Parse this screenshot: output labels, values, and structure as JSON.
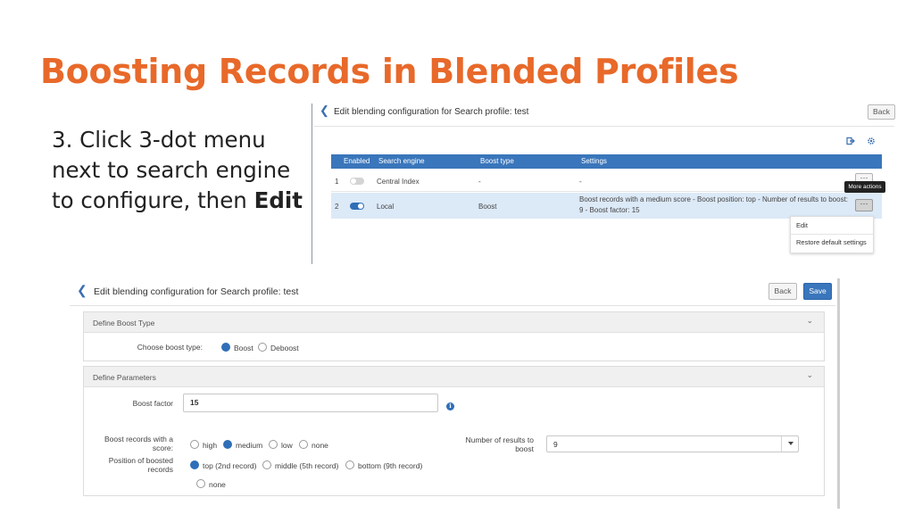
{
  "slide": {
    "title": "Boosting Records in Blended Profiles",
    "instruction_prefix": "3. Click 3-dot menu next to search engine to configure, then ",
    "instruction_bold": "Edit",
    "title_color": "#e8692a"
  },
  "top_screenshot": {
    "header_title": "Edit blending configuration for Search profile: test",
    "back_label": "Back",
    "toolbar_icons": [
      "export-icon",
      "gear-icon"
    ],
    "table": {
      "columns": [
        "Enabled",
        "Search engine",
        "Boost type",
        "Settings"
      ],
      "rows": [
        {
          "num": "1",
          "enabled": false,
          "engine": "Central Index",
          "boost_type": "-",
          "settings": "-"
        },
        {
          "num": "2",
          "enabled": true,
          "engine": "Local",
          "boost_type": "Boost",
          "settings_line1": "Boost records with a medium score - Boost position: top - Number of results to boost:",
          "settings_line2": "9 - Boost factor: 15"
        }
      ]
    },
    "more_actions_tooltip": "More actions",
    "row_actions_glyph": "···",
    "menu_items": [
      "Edit",
      "Restore default settings"
    ],
    "header_color": "#3a76bb"
  },
  "bottom_screenshot": {
    "header_title": "Edit blending configuration for Search profile: test",
    "back_label": "Back",
    "save_label": "Save",
    "define_boost_type": {
      "title": "Define Boost Type",
      "choose_label": "Choose boost type:",
      "options": [
        "Boost",
        "Deboost"
      ],
      "selected": "Boost"
    },
    "define_parameters": {
      "title": "Define Parameters",
      "boost_factor_label": "Boost factor",
      "boost_factor_value": "15",
      "score_label": "Boost records with a score:",
      "score_options": [
        "high",
        "medium",
        "low",
        "none"
      ],
      "score_selected": "medium",
      "results_label": "Number of results to boost",
      "results_value": "9",
      "position_label": "Position of boosted records",
      "position_options": [
        "top (2nd record)",
        "middle (5th record)",
        "bottom (9th record)",
        "none"
      ],
      "position_selected": "top (2nd record)"
    },
    "accent_color": "#2f6fb8"
  }
}
